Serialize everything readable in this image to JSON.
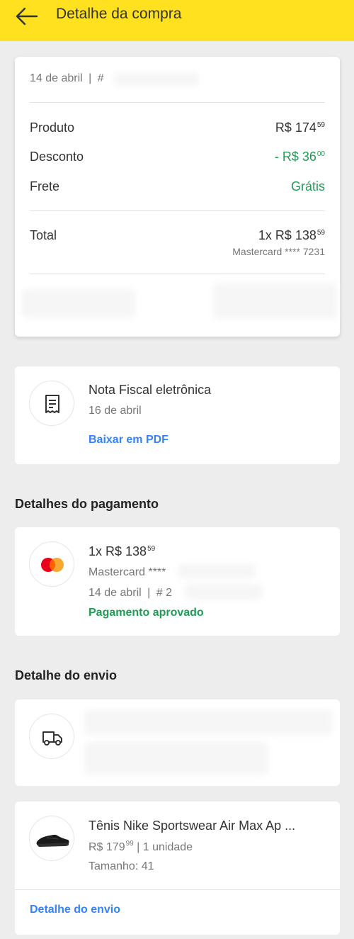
{
  "header": {
    "title": "Detalhe da compra"
  },
  "summary": {
    "date": "14 de abril",
    "separator": "|",
    "order_prefix": "#",
    "produto_label": "Produto",
    "produto_value": "R$ 174",
    "produto_cents": "59",
    "desconto_label": "Desconto",
    "desconto_value": "- R$ 36",
    "desconto_cents": "00",
    "frete_label": "Frete",
    "frete_value": "Grátis",
    "total_label": "Total",
    "total_value": "1x R$ 138",
    "total_cents": "59",
    "card_info": "Mastercard **** 7231"
  },
  "invoice": {
    "title": "Nota Fiscal eletrônica",
    "date": "16 de abril",
    "download": "Baixar em PDF"
  },
  "payment": {
    "section_title": "Detalhes do pagamento",
    "amount": "1x R$ 138",
    "amount_cents": "59",
    "card": "Mastercard ****",
    "date": "14 de abril",
    "separator": "|",
    "order_prefix": "# 2",
    "status": "Pagamento aprovado"
  },
  "shipping": {
    "section_title": "Detalhe do envio"
  },
  "product": {
    "name": "Tênis Nike Sportswear Air Max Ap ...",
    "price": "R$ 179",
    "price_cents": "99",
    "quantity": "| 1 unidade",
    "size": "Tamanho: 41",
    "link": "Detalhe do envio"
  },
  "colors": {
    "header": "#ffe11f",
    "green": "#1f9d55",
    "link": "#3483fa"
  }
}
